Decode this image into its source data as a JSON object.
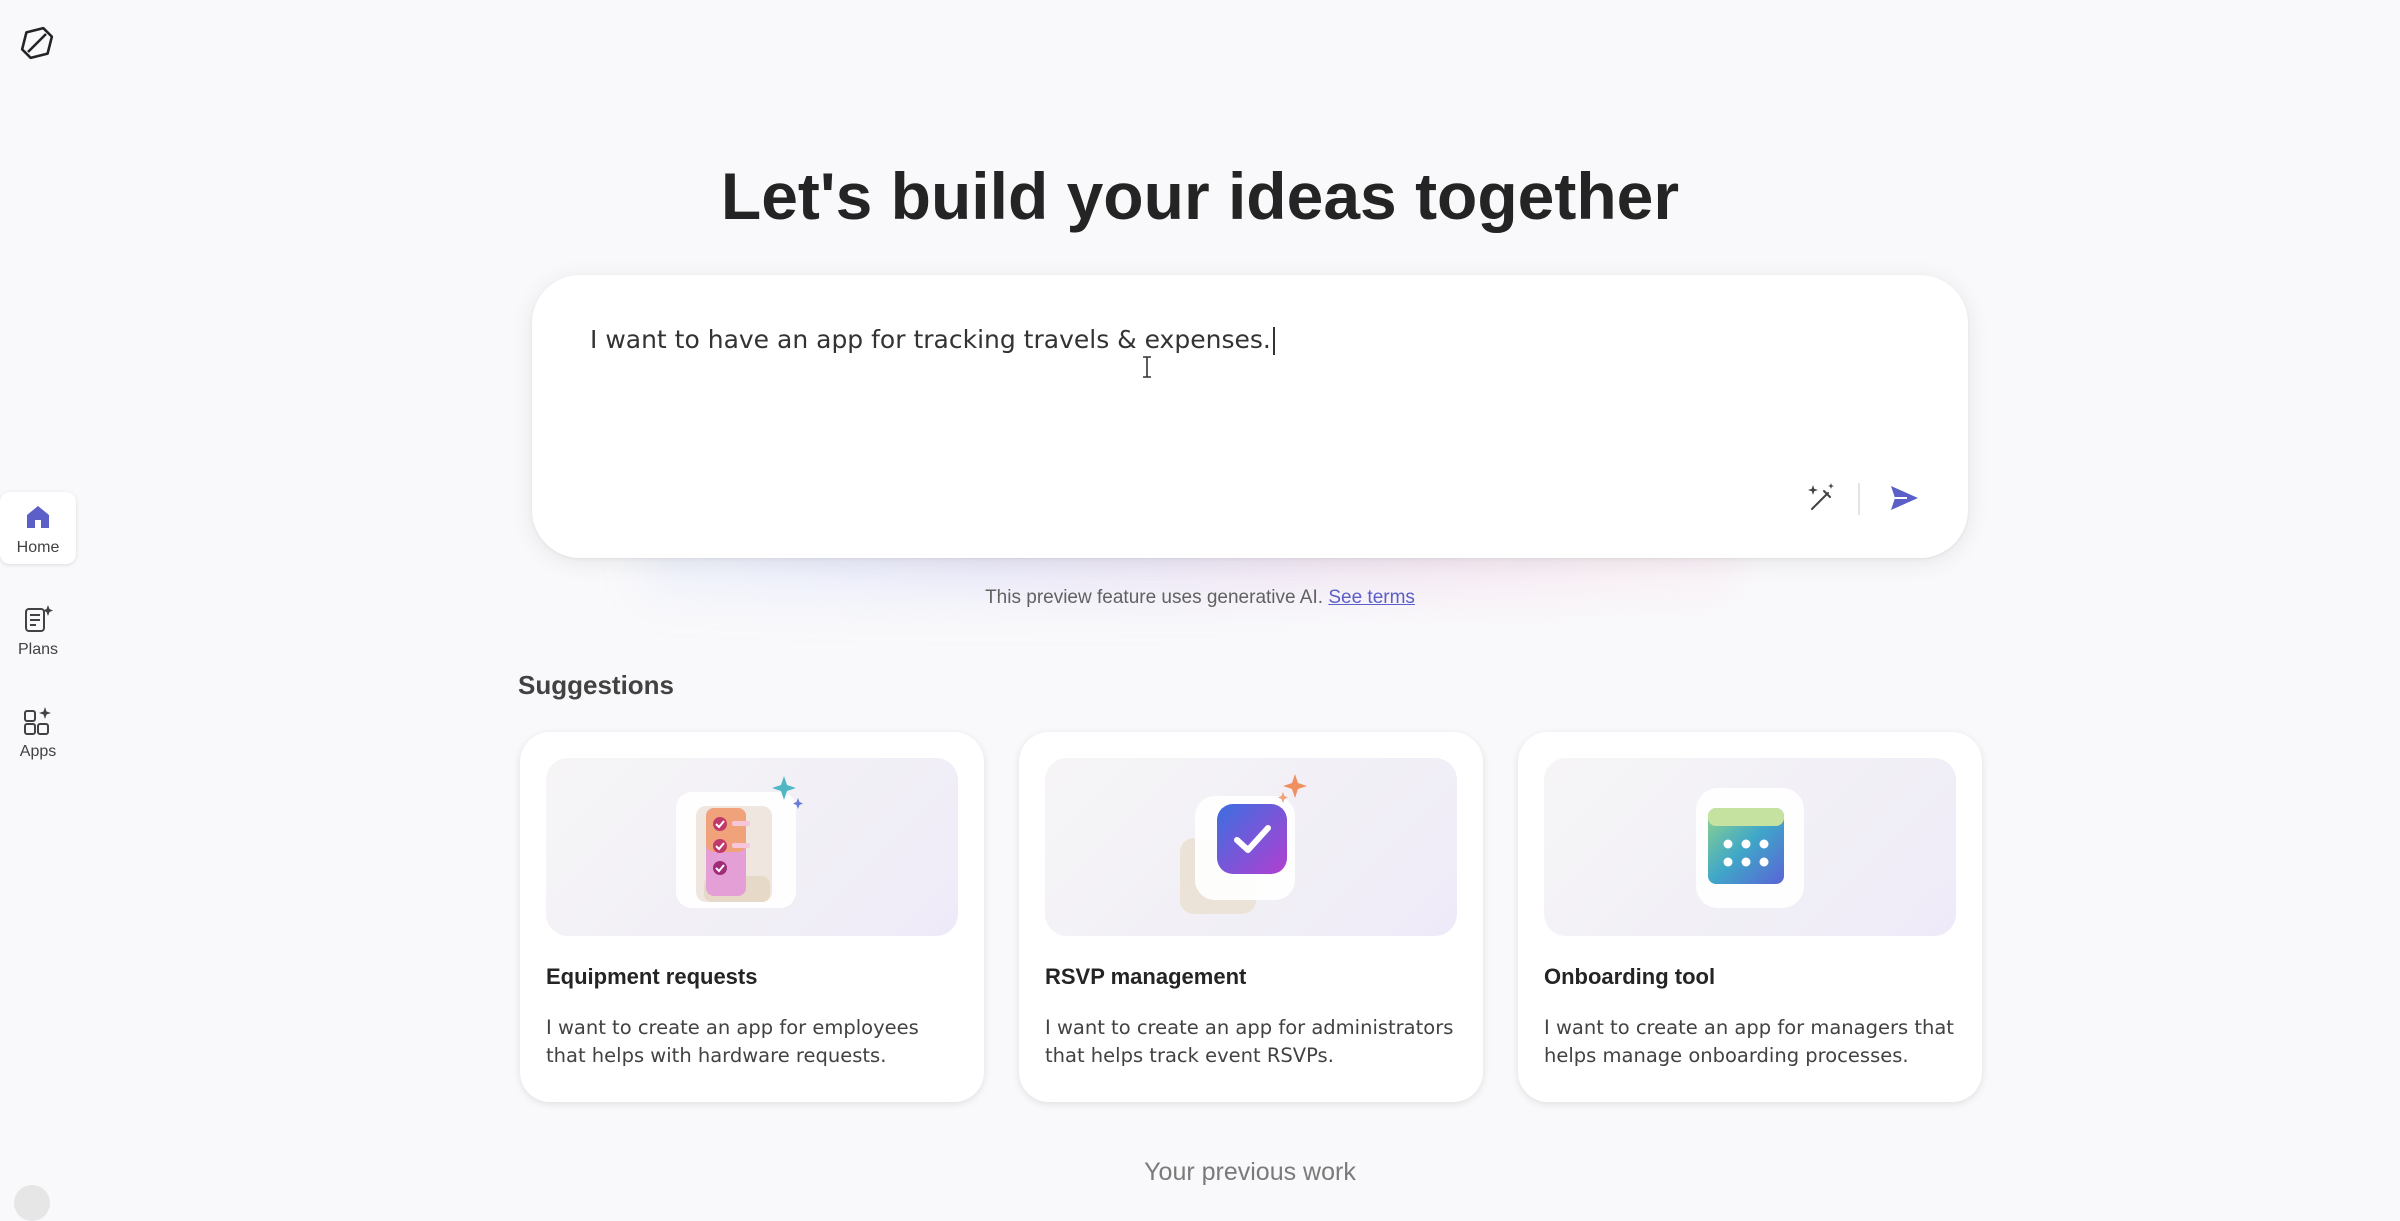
{
  "logo": {
    "icon": "app-logo-icon"
  },
  "nav": {
    "items": [
      {
        "label": "Home",
        "icon": "home-icon",
        "active": true
      },
      {
        "label": "Plans",
        "icon": "plans-icon",
        "active": false
      },
      {
        "label": "Apps",
        "icon": "apps-icon",
        "active": false
      }
    ]
  },
  "hero": {
    "title": "Let's build your ideas together"
  },
  "prompt": {
    "value": "I want to have an app for tracking travels & expenses.",
    "enhance_icon": "magic-wand-icon",
    "send_icon": "send-icon"
  },
  "disclaimer": {
    "text": "This preview feature uses generative AI.",
    "link": "See terms"
  },
  "suggestions": {
    "title": "Suggestions",
    "cards": [
      {
        "title": "Equipment requests",
        "description": "I want to create an app for employees that helps with hardware requests.",
        "icon": "checklist-icon"
      },
      {
        "title": "RSVP management",
        "description": "I want to create an app for administrators that helps track event RSVPs.",
        "icon": "checkmark-badge-icon"
      },
      {
        "title": "Onboarding tool",
        "description": "I want to create an app for managers that helps manage onboarding processes.",
        "icon": "calendar-icon"
      }
    ]
  },
  "previous_work": {
    "title": "Your previous work"
  },
  "colors": {
    "accent": "#5b5fc7",
    "background": "#f9f9fb"
  }
}
